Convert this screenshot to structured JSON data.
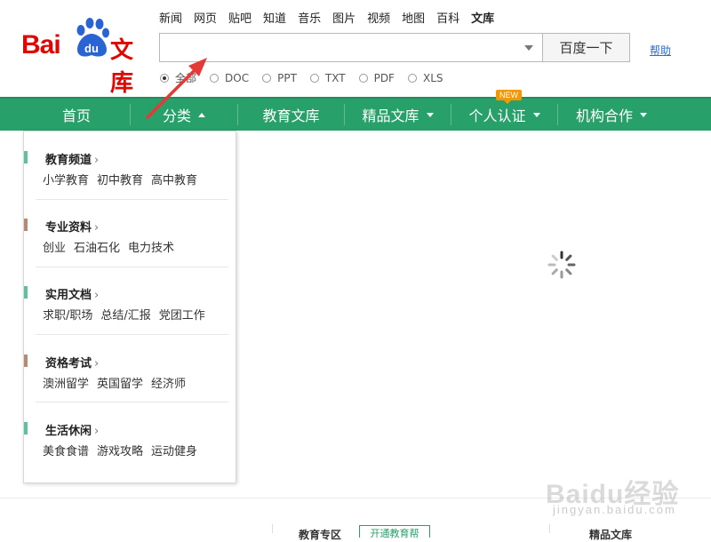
{
  "logo": {
    "part1": "Bai",
    "paw_text": "du",
    "part2": "文库"
  },
  "top_links": [
    "新闻",
    "网页",
    "贴吧",
    "知道",
    "音乐",
    "图片",
    "视频",
    "地图",
    "百科",
    "文库"
  ],
  "search": {
    "value": "",
    "placeholder": "",
    "button_label": "百度一下",
    "help_label": "帮助"
  },
  "filters": [
    {
      "label": "全部",
      "selected": true
    },
    {
      "label": "DOC",
      "selected": false
    },
    {
      "label": "PPT",
      "selected": false
    },
    {
      "label": "TXT",
      "selected": false
    },
    {
      "label": "PDF",
      "selected": false
    },
    {
      "label": "XLS",
      "selected": false
    }
  ],
  "nav": {
    "items": [
      {
        "label": "首页"
      },
      {
        "label": "分类"
      },
      {
        "label": "教育文库"
      },
      {
        "label": "精品文库"
      },
      {
        "label": "个人认证"
      },
      {
        "label": "机构合作"
      }
    ],
    "badge": "NEW"
  },
  "categories": [
    {
      "title": "教育频道",
      "chevron": "›",
      "color": "#5ac39a",
      "links": [
        "小学教育",
        "初中教育",
        "高中教育"
      ]
    },
    {
      "title": "专业资料",
      "chevron": "›",
      "color": "#b58b72",
      "links": [
        "创业",
        "石油石化",
        "电力技术"
      ]
    },
    {
      "title": "实用文档",
      "chevron": "›",
      "color": "#5ac39a",
      "links": [
        "求职/职场",
        "总结/汇报",
        "党团工作"
      ]
    },
    {
      "title": "资格考试",
      "chevron": "›",
      "color": "#b58b72",
      "links": [
        "澳洲留学",
        "英国留学",
        "经济师"
      ]
    },
    {
      "title": "生活休闲",
      "chevron": "›",
      "color": "#5ac39a",
      "links": [
        "美食食谱",
        "游戏攻略",
        "运动健身"
      ]
    }
  ],
  "bottom": {
    "left_title": "教育专区",
    "button": "开通教育帮",
    "right_title": "精品文库"
  },
  "watermark": {
    "text": "Baidu经验",
    "url": "jingyan.baidu.com"
  },
  "colors": {
    "brand_red": "#e10601",
    "nav_green": "#27a06a",
    "link_blue": "#2a6ccf",
    "badge_orange": "#f39800"
  }
}
